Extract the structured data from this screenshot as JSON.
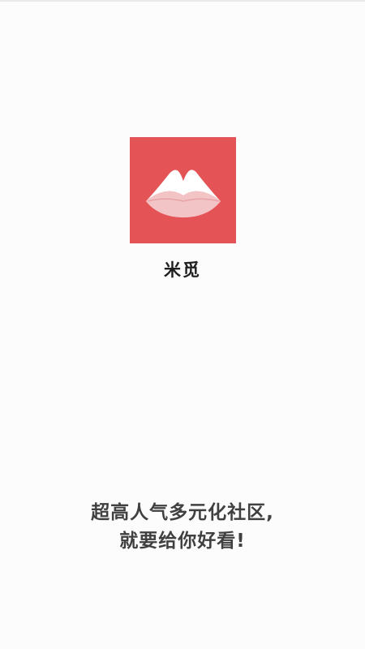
{
  "app": {
    "name": "米觅",
    "logo_icon": "mountain-lips-logo-icon",
    "brand_color": "#e45457"
  },
  "splash": {
    "slogan_line1": "超高人气多元化社区,",
    "slogan_line2": "就要给你好看!"
  }
}
